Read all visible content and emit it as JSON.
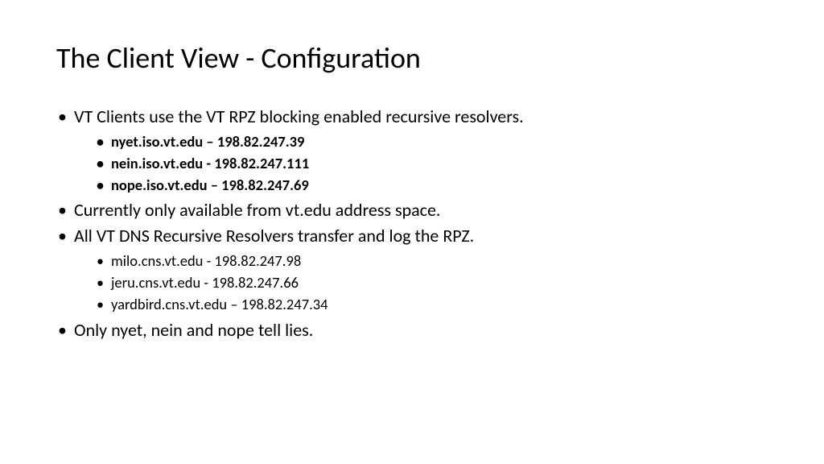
{
  "title": "The Client View - Configuration",
  "bullets": {
    "b1": "VT Clients use the VT RPZ blocking enabled recursive resolvers.",
    "b1_sub": {
      "s1": "nyet.iso.vt.edu – 198.82.247.39",
      "s2": "nein.iso.vt.edu -  198.82.247.111",
      "s3": "nope.iso.vt.edu – 198.82.247.69"
    },
    "b2": "Currently only available from vt.edu address space.",
    "b3": "All VT DNS Recursive Resolvers transfer and log the RPZ.",
    "b3_sub": {
      "s1": "milo.cns.vt.edu - 198.82.247.98",
      "s2": "jeru.cns.vt.edu -  198.82.247.66",
      "s3": "yardbird.cns.vt.edu – 198.82.247.34"
    },
    "b4": "Only nyet, nein and nope tell lies."
  }
}
